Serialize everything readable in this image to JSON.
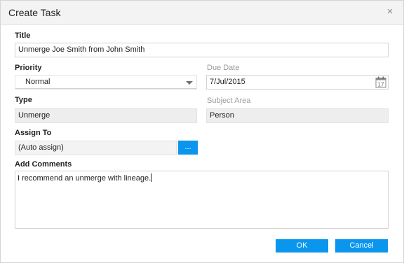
{
  "dialog": {
    "title": "Create Task",
    "close_glyph": "×"
  },
  "form": {
    "title": {
      "label": "Title",
      "value": "Unmerge Joe Smith from John Smith"
    },
    "priority": {
      "label": "Priority",
      "value": "Normal"
    },
    "due_date": {
      "label": "Due Date",
      "value": "7/Jul/2015",
      "icon": "calendar-icon",
      "icon_day": "17"
    },
    "type": {
      "label": "Type",
      "value": "Unmerge"
    },
    "subject_area": {
      "label": "Subject Area",
      "value": "Person"
    },
    "assign_to": {
      "label": "Assign To",
      "value": "(Auto assign)",
      "browse_label": "..."
    },
    "comments": {
      "label": "Add Comments",
      "value": "I recommend an unmerge with lineage."
    }
  },
  "buttons": {
    "ok": "OK",
    "cancel": "Cancel"
  },
  "colors": {
    "accent": "#0b96ee",
    "readonly_bg": "#eeeeee",
    "titlebar_bg": "#f3f3f3"
  }
}
